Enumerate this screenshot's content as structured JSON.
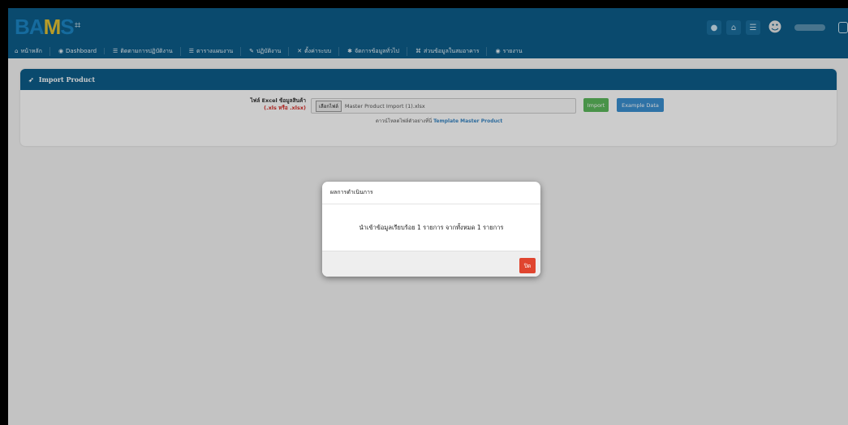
{
  "header": {
    "logo_left": "BA",
    "logo_mid": "M",
    "logo_right": "S",
    "sidebar_toggle_icon": "expand-icon",
    "right_icons": [
      "notification-icon",
      "home-icon",
      "list-icon",
      "user-avatar-icon",
      "logout-icon"
    ]
  },
  "menu": {
    "items": [
      {
        "icon": "home-icon",
        "glyph": "⌂",
        "label": "หน้าหลัก"
      },
      {
        "icon": "dashboard-icon",
        "glyph": "◉",
        "label": "Dashboard"
      },
      {
        "icon": "list-icon",
        "glyph": "☰",
        "label": "ติดตามการปฏิบัติงาน"
      },
      {
        "icon": "list-icon",
        "glyph": "☰",
        "label": "ตารางแผนงาน"
      },
      {
        "icon": "edit-icon",
        "glyph": "✎",
        "label": "ปฏิบัติงาน"
      },
      {
        "icon": "settings-icon",
        "glyph": "✕",
        "label": "ตั้งค่าระบบ"
      },
      {
        "icon": "gear-icon",
        "glyph": "✱",
        "label": "จัดการข้อมูลทั่วไป"
      },
      {
        "icon": "building-icon",
        "glyph": "⌘",
        "label": "ส่วนข้อมูลในสมอาคาร"
      },
      {
        "icon": "report-icon",
        "glyph": "◉",
        "label": "รายงาน"
      }
    ]
  },
  "import_panel": {
    "title": "Import Product",
    "title_icon": "rocket-icon",
    "field_label": "ไฟล์ Excel ข้อมูลสินค้า",
    "field_sublabel": "(.xls หรือ .xlsx)",
    "file_button_label": "เลือกไฟล์",
    "file_value": "Master Product Import (1).xlsx",
    "import_button": "Import",
    "example_button": "Example Data",
    "template_note": "ดาวน์โหลดไฟล์ตัวอย่างที่นี่",
    "template_link": "Template Master Product"
  },
  "modal": {
    "title": "ผลการดำเนินการ",
    "message": "นำเข้าข้อมูลเรียบร้อย 1 รายการ จากทั้งหมด 1 รายการ",
    "close_button": "ปิด"
  },
  "colors": {
    "header": "#0d5d8a",
    "success": "#5cb85c",
    "info": "#3a8fd0",
    "danger": "#e0452f"
  }
}
